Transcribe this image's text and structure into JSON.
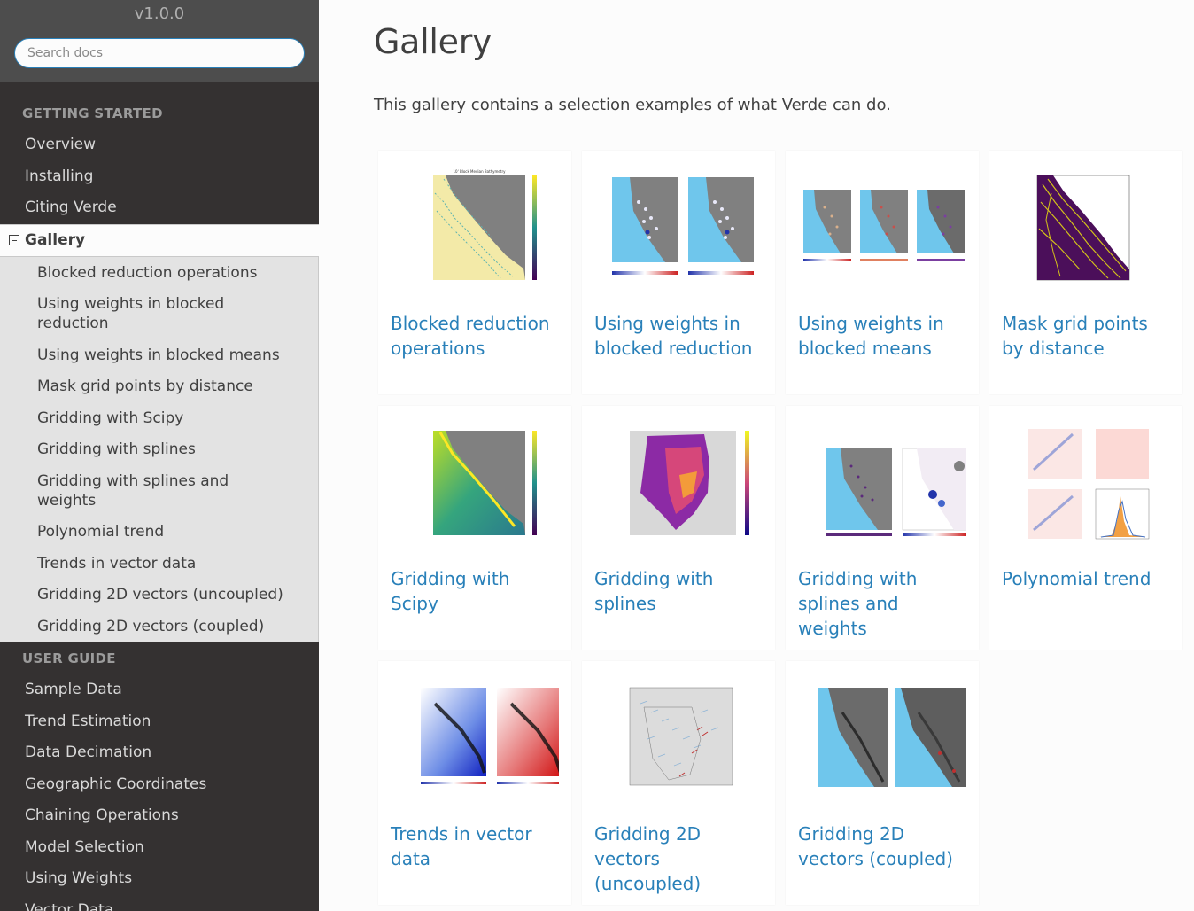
{
  "sidebar": {
    "version": "v1.0.0",
    "search_placeholder": "Search docs",
    "getting_started": {
      "caption": "GETTING STARTED",
      "items": [
        "Overview",
        "Installing",
        "Citing Verde"
      ]
    },
    "current": "Gallery",
    "gallery_items": [
      "Blocked reduction operations",
      "Using weights in blocked reduction",
      "Using weights in blocked means",
      "Mask grid points by distance",
      "Gridding with Scipy",
      "Gridding with splines",
      "Gridding with splines and weights",
      "Polynomial trend",
      "Trends in vector data",
      "Gridding 2D vectors (uncoupled)",
      "Gridding 2D vectors (coupled)"
    ],
    "user_guide": {
      "caption": "USER GUIDE",
      "items": [
        "Sample Data",
        "Trend Estimation",
        "Data Decimation",
        "Geographic Coordinates",
        "Chaining Operations",
        "Model Selection",
        "Using Weights",
        "Vector Data"
      ]
    }
  },
  "main": {
    "title": "Gallery",
    "intro": "This gallery contains a selection examples of what Verde can do.",
    "cards": [
      {
        "label": "Blocked reduction operations",
        "thumb": "bathymetry-map"
      },
      {
        "label": "Using weights in blocked reduction",
        "thumb": "weights-maps"
      },
      {
        "label": "Using weights in blocked means",
        "thumb": "uncertainty-maps"
      },
      {
        "label": "Mask grid points by distance",
        "thumb": "mask-map"
      },
      {
        "label": "Gridding with Scipy",
        "thumb": "scipy-grid-map"
      },
      {
        "label": "Gridding with splines",
        "thumb": "temperature-map"
      },
      {
        "label": "Gridding with splines and weights",
        "thumb": "velocity-maps"
      },
      {
        "label": "Polynomial trend",
        "thumb": "trend-panels"
      },
      {
        "label": "Trends in vector data",
        "thumb": "vector-trend-maps"
      },
      {
        "label": "Gridding 2D vectors (uncoupled)",
        "thumb": "wind-map"
      },
      {
        "label": "Gridding 2D vectors (coupled)",
        "thumb": "gps-vector-maps"
      }
    ]
  },
  "colors": {
    "sidebar_bg": "#343131",
    "sidebar_top_bg": "#4d4d4d",
    "link": "#2980b9",
    "text": "#404040",
    "ocean": "#6fc6ec",
    "land_gray": "#808080"
  }
}
